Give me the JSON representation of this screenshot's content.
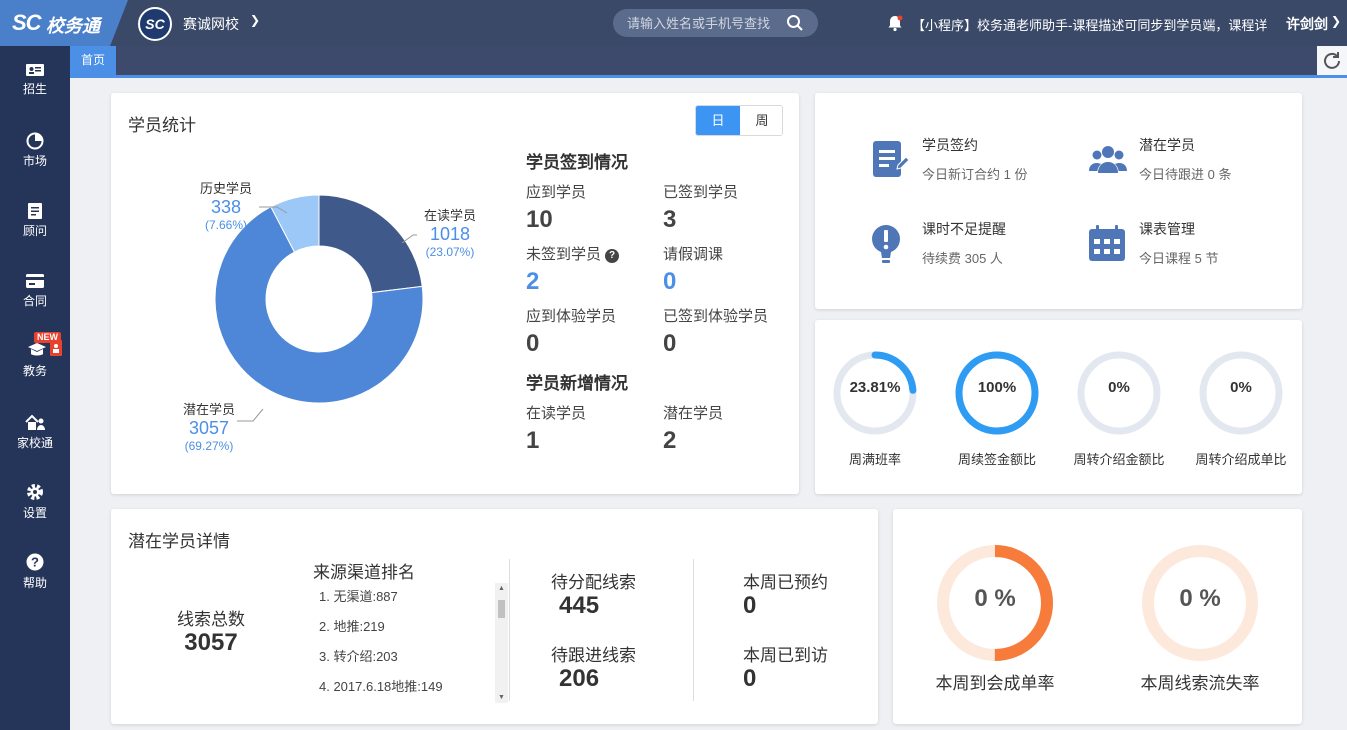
{
  "header": {
    "logo_mark": "SC",
    "logo_text": "校务通",
    "school_badge": "SC",
    "school_name": "赛诚网校",
    "search_placeholder": "请输入姓名或手机号查找",
    "notice": "【小程序】校务通老师助手-课程描述可同步到学员端，课程详",
    "user_name": "许剑剑"
  },
  "sidebar": {
    "new_badge": "NEW",
    "items": [
      {
        "label": "招生",
        "icon": "id-card-icon"
      },
      {
        "label": "市场",
        "icon": "pie-chart-icon"
      },
      {
        "label": "顾问",
        "icon": "document-icon"
      },
      {
        "label": "合同",
        "icon": "card-icon"
      },
      {
        "label": "教务",
        "icon": "graduation-cap-icon"
      },
      {
        "label": "家校通",
        "icon": "family-icon"
      },
      {
        "label": "设置",
        "icon": "gear-icon"
      },
      {
        "label": "帮助",
        "icon": "question-icon"
      }
    ]
  },
  "tabs": {
    "home": "首页"
  },
  "student_stats": {
    "title": "学员统计",
    "toggle_day": "日",
    "toggle_week": "周",
    "checkin_title": "学员签到情况",
    "checkin": [
      {
        "label": "应到学员",
        "value": "10"
      },
      {
        "label": "已签到学员",
        "value": "3"
      },
      {
        "label": "未签到学员",
        "value": "2"
      },
      {
        "label": "请假调课",
        "value": "0"
      },
      {
        "label": "应到体验学员",
        "value": "0"
      },
      {
        "label": "已签到体验学员",
        "value": "0"
      }
    ],
    "new_title": "学员新增情况",
    "new": [
      {
        "label": "在读学员",
        "value": "1"
      },
      {
        "label": "潜在学员",
        "value": "2"
      }
    ]
  },
  "chart_data": {
    "type": "pie",
    "donut": true,
    "slices": [
      {
        "name": "在读学员",
        "value": 1018,
        "percent": "(23.07%)",
        "color": "#3f5a8a"
      },
      {
        "name": "潜在学员",
        "value": 3057,
        "percent": "(69.27%)",
        "color": "#4e86d8"
      },
      {
        "name": "历史学员",
        "value": 338,
        "percent": "(7.66%)",
        "color": "#9cc8f7"
      }
    ]
  },
  "quick_links": [
    {
      "title": "学员签约",
      "sub": "今日新订合约 1 份",
      "icon": "contract-icon"
    },
    {
      "title": "潜在学员",
      "sub": "今日待跟进 0 条",
      "icon": "users-icon"
    },
    {
      "title": "课时不足提醒",
      "sub": "待续费 305 人",
      "icon": "alert-icon"
    },
    {
      "title": "课表管理",
      "sub": "今日课程 5 节",
      "icon": "calendar-icon"
    }
  ],
  "weekly_rings": [
    {
      "label": "周满班率",
      "value": "23.81%",
      "fraction": 0.2381
    },
    {
      "label": "周续签金额比",
      "value": "100%",
      "fraction": 1.0
    },
    {
      "label": "周转介绍金额比",
      "value": "0%",
      "fraction": 0
    },
    {
      "label": "周转介绍成单比",
      "value": "0%",
      "fraction": 0
    }
  ],
  "leads": {
    "title": "潜在学员详情",
    "total_label": "线索总数",
    "total_value": "3057",
    "rank_title": "来源渠道排名",
    "rank_items": [
      "1. 无渠道:887",
      "2. 地推:219",
      "3. 转介绍:203",
      "4. 2017.6.18地推:149"
    ],
    "stats": [
      {
        "label": "待分配线索",
        "value": "445"
      },
      {
        "label": "本周已预约",
        "value": "0"
      },
      {
        "label": "待跟进线索",
        "value": "206"
      },
      {
        "label": "本周已到访",
        "value": "0"
      }
    ]
  },
  "rates": [
    {
      "label": "本周到会成单率",
      "value": "0 %",
      "fraction": 0.5
    },
    {
      "label": "本周线索流失率",
      "value": "0 %",
      "fraction": 0
    }
  ],
  "colors": {
    "accent": "#4b8fe6",
    "ring_blue": "#2f9cf4",
    "ring_orange": "#f77b3b",
    "ring_track": "#e3e8f0",
    "orange_track": "#fde9dc"
  }
}
